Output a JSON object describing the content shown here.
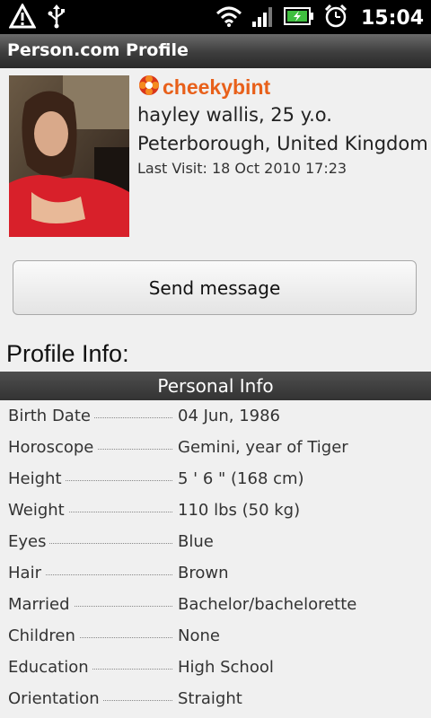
{
  "status_bar": {
    "time": "15:04",
    "icons": [
      "alert-icon",
      "usb-icon",
      "wifi-icon",
      "signal-icon",
      "battery-charging-icon",
      "alarm-icon"
    ]
  },
  "app": {
    "title": "Person.com Profile"
  },
  "profile": {
    "username": "cheekybint",
    "fullname": "hayley wallis, 25 y.o.",
    "location": "Peterborough, United Kingdom",
    "last_visit": "Last Visit: 18 Oct 2010 17:23"
  },
  "actions": {
    "send_message": "Send message"
  },
  "profile_info": {
    "heading": "Profile Info:",
    "section_title": "Personal Info",
    "rows": [
      {
        "label": "Birth Date",
        "value": "04 Jun, 1986"
      },
      {
        "label": "Horoscope",
        "value": "Gemini, year of Tiger"
      },
      {
        "label": "Height",
        "value": "5 ' 6 \" (168 cm)"
      },
      {
        "label": "Weight",
        "value": "110 lbs (50 kg)"
      },
      {
        "label": "Eyes",
        "value": "Blue"
      },
      {
        "label": "Hair",
        "value": "Brown"
      },
      {
        "label": "Married",
        "value": "Bachelor/bachelorette"
      },
      {
        "label": "Children",
        "value": "None"
      },
      {
        "label": "Education",
        "value": "High School"
      },
      {
        "label": "Orientation",
        "value": "Straight"
      }
    ]
  },
  "colors": {
    "accent": "#e8601a",
    "title_bar": "#3d3d3d",
    "background": "#f0f0f0"
  }
}
